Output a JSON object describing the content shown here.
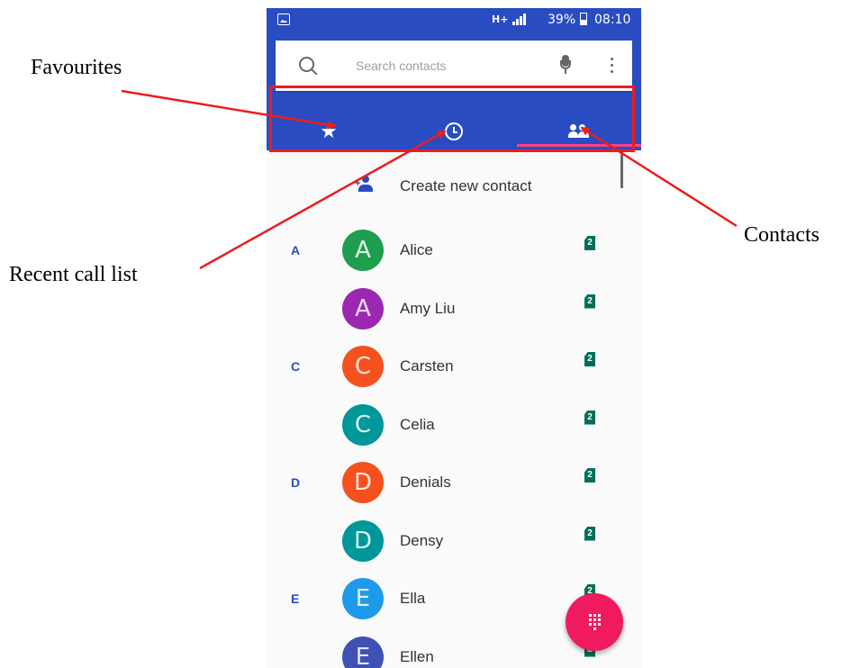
{
  "annotations": {
    "favourites": "Favourites",
    "recent_call_list": "Recent call list",
    "contacts": "Contacts"
  },
  "status_bar": {
    "network": "H+",
    "battery": "39%",
    "time": "08:10"
  },
  "search": {
    "placeholder": "Search contacts"
  },
  "tabs": [
    {
      "name": "favourites",
      "icon": "star-icon"
    },
    {
      "name": "recent",
      "icon": "clock-icon"
    },
    {
      "name": "contacts",
      "icon": "people-icon",
      "selected": true
    }
  ],
  "create_contact": {
    "label": "Create new contact"
  },
  "contacts": [
    {
      "section": "A",
      "initial": "A",
      "name": "Alice",
      "color": "#1e9e4e"
    },
    {
      "section": "",
      "initial": "A",
      "name": "Amy Liu",
      "color": "#9c27b0"
    },
    {
      "section": "C",
      "initial": "C",
      "name": "Carsten",
      "color": "#f4511e"
    },
    {
      "section": "",
      "initial": "C",
      "name": "Celia",
      "color": "#00979a"
    },
    {
      "section": "D",
      "initial": "D",
      "name": "Denials",
      "color": "#f4511e"
    },
    {
      "section": "",
      "initial": "D",
      "name": "Densy",
      "color": "#00979a"
    },
    {
      "section": "E",
      "initial": "E",
      "name": "Ella",
      "color": "#1e9be8"
    },
    {
      "section": "",
      "initial": "E",
      "name": "Ellen",
      "color": "#3f51b5"
    }
  ],
  "sim_label": "2",
  "colors": {
    "header": "#2a4cc2",
    "fab": "#f01a5e",
    "annotation": "#ee1c1c",
    "tab_indicator": "#ff4081"
  }
}
